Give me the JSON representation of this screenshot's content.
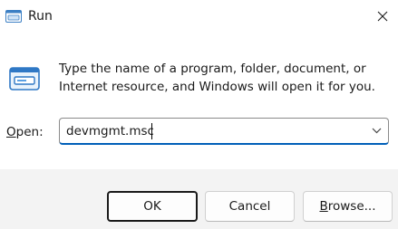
{
  "window": {
    "title": "Run",
    "app_icon": "run-dialog-icon",
    "close_icon": "close-icon"
  },
  "description": "Type the name of a program, folder, document, or Internet resource, and Windows will open it for you.",
  "open_field": {
    "label_accel": "O",
    "label_rest": "pen:",
    "value": "devmgmt.msc",
    "dropdown_icon": "chevron-down-icon"
  },
  "buttons": {
    "ok": "OK",
    "cancel": "Cancel",
    "browse_accel": "B",
    "browse_rest": "rowse..."
  },
  "colors": {
    "accent": "#005fb8",
    "footer_bg": "#f3f3f3"
  }
}
